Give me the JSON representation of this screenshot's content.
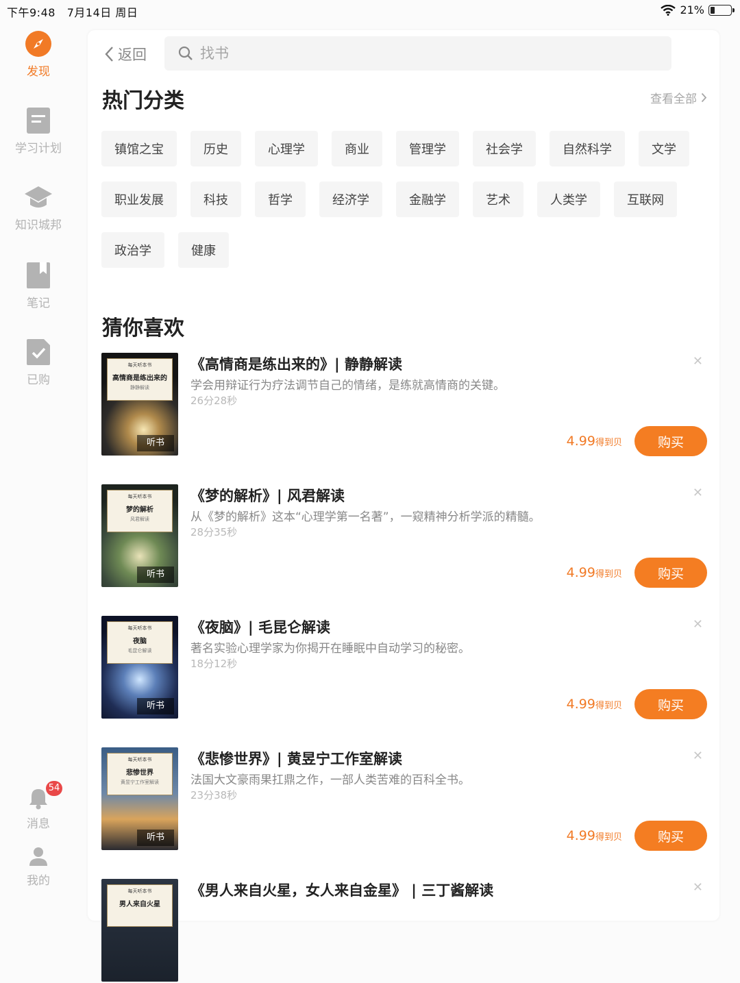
{
  "status_bar": {
    "time": "下午9:48",
    "date": "7月14日 周日",
    "battery": "21%",
    "battery_level": 0.21
  },
  "sidebar": {
    "items": [
      {
        "label": "发现",
        "icon": "compass-icon",
        "active": true
      },
      {
        "label": "学习计划",
        "icon": "document-icon"
      },
      {
        "label": "知识城邦",
        "icon": "graduation-cap-icon"
      },
      {
        "label": "笔记",
        "icon": "bookmark-icon"
      },
      {
        "label": "已购",
        "icon": "purchased-check-icon"
      }
    ],
    "messages": {
      "label": "消息",
      "icon": "bell-icon",
      "badge": "54"
    },
    "profile": {
      "label": "我的",
      "icon": "user-icon"
    }
  },
  "header": {
    "back_label": "返回",
    "search_placeholder": "找书"
  },
  "hot_categories": {
    "title": "热门分类",
    "see_all": "查看全部",
    "rows": [
      [
        "镇馆之宝",
        "历史",
        "心理学",
        "商业",
        "管理学",
        "社会学",
        "自然科学",
        "文学"
      ],
      [
        "职业发展",
        "科技",
        "哲学",
        "经济学",
        "金融学",
        "艺术",
        "人类学",
        "互联网"
      ],
      [
        "政治学",
        "健康"
      ]
    ]
  },
  "recommend": {
    "title": "猜你喜欢",
    "listen_label": "听书",
    "buy_label": "购买",
    "cover_series": "每天听本书",
    "books": [
      {
        "title": "《高情商是练出来的》| 静静解读",
        "desc": "学会用辩证行为疗法调节自己的情绪，是练就高情商的关键。",
        "duration": "26分28秒",
        "price": "4.99",
        "unit": "得到贝",
        "cover_title": "高情商是练出来的",
        "cover_sub": "静静解读"
      },
      {
        "title": "《梦的解析》| 风君解读",
        "desc": "从《梦的解析》这本“心理学第一名著”，一窥精神分析学派的精髓。",
        "duration": "28分35秒",
        "price": "4.99",
        "unit": "得到贝",
        "cover_title": "梦的解析",
        "cover_sub": "风君解读"
      },
      {
        "title": "《夜脑》| 毛昆仑解读",
        "desc": "著名实验心理学家为你揭开在睡眠中自动学习的秘密。",
        "duration": "18分12秒",
        "price": "4.99",
        "unit": "得到贝",
        "cover_title": "夜脑",
        "cover_sub": "毛昆仑解读"
      },
      {
        "title": "《悲惨世界》| 黄昱宁工作室解读",
        "desc": "法国大文豪雨果扛鼎之作，一部人类苦难的百科全书。",
        "duration": "23分38秒",
        "price": "4.99",
        "unit": "得到贝",
        "cover_title": "悲惨世界",
        "cover_sub": "黄昱宁工作室解读"
      },
      {
        "title": "《男人来自火星，女人来自金星》 | 三丁酱解读",
        "cover_title": "男人来自火星"
      }
    ]
  },
  "colors": {
    "accent": "#f17a26",
    "muted": "#b3b3b3",
    "badge": "#e94848"
  }
}
